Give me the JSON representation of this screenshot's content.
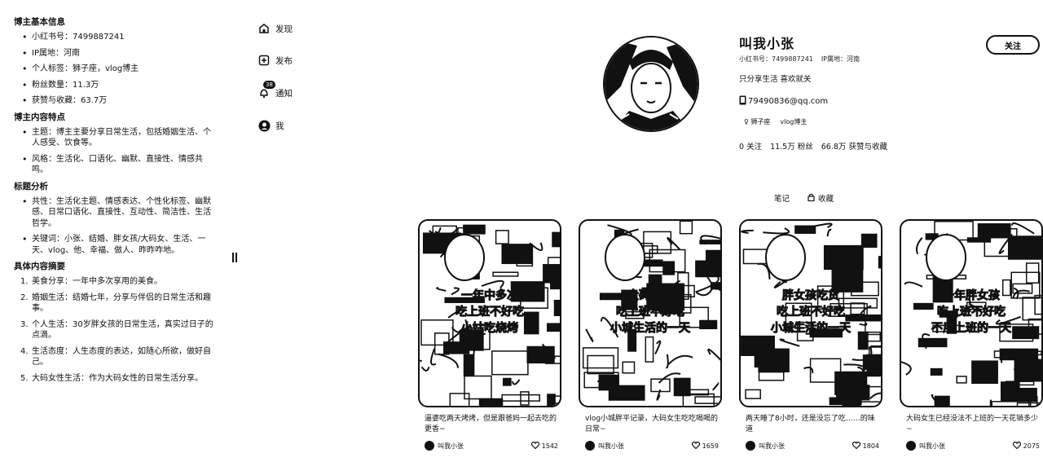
{
  "left_panel": {
    "sections": [
      {
        "title": "博主基本信息",
        "type": "bullets",
        "items": [
          "小红书号：7499887241",
          "IP属地：河南",
          "个人标签：狮子座，vlog博主",
          "粉丝数量：11.3万",
          "获赞与收藏：63.7万"
        ]
      },
      {
        "title": "博主内容特点",
        "type": "bullets",
        "items": [
          "主题：博主主要分享日常生活，包括婚姻生活、个人感受、饮食等。",
          "风格：生活化、口语化、幽默、直接性、情感共鸣。"
        ]
      },
      {
        "title": "标题分析",
        "type": "bullets",
        "items": [
          "共性：生活化主题、情感表达、个性化标签、幽默感、日常口语化、直接性、互动性、简洁性、生活哲学。",
          "关键词：小张、结婚、胖女孩/大码女、生活、一天、vlog、他、幸福、做人、昨昨咋地。"
        ]
      },
      {
        "title": "具体内容摘要",
        "type": "numbered",
        "items": [
          "美食分享：一年中多次享用的美食。",
          "婚姻生活：结婚七年，分享与伴侣的日常生活和趣事。",
          "个人生活：30岁胖女孩的日常生活，真实过日子的点滴。",
          "生活态度：人生态度的表达，如随心所欲，做好自己。",
          "大码女性生活：作为大码女性的日常生活分享。"
        ]
      }
    ]
  },
  "nav": {
    "items": [
      {
        "label": "发现",
        "icon": "home-icon"
      },
      {
        "label": "发布",
        "icon": "plus-square-icon"
      },
      {
        "label": "通知",
        "icon": "bell-icon",
        "badge": "38"
      },
      {
        "label": "我",
        "icon": "user-avatar-icon"
      }
    ]
  },
  "profile": {
    "name": "叫我小张",
    "id_label": "小红书号：7499887241",
    "ip_label": "IP属地：河南",
    "description": "只分享生活 喜欢就关",
    "email": "79490836@qq.com",
    "tags": [
      "♀ 狮子座",
      "vlog博主"
    ],
    "stats": {
      "following": "0 关注",
      "followers": "11.5万 粉丝",
      "likes": "66.8万 获赞与收藏"
    },
    "follow_label": "关注"
  },
  "tabs": {
    "notes": "笔记",
    "collections": "收藏"
  },
  "notes": [
    {
      "title": "逼婆吃两天烤烤，但是跟爸妈一起去吃的更香~",
      "author": "叫我小张",
      "likes": "1542",
      "overlay": [
        "一年中多次",
        "吃上班不好吃",
        "小姑吃烧烤"
      ]
    },
    {
      "title": "vlog小城胖平记录，大码女生吃吃喝喝的日常~",
      "author": "叫我小张",
      "likes": "1659",
      "overlay": [
        "大码女生",
        "吃上班不好吃",
        "小城生活的一天"
      ]
    },
    {
      "title": "两天睡了8小时，还是没忘了吃……的味道",
      "author": "叫我小张",
      "likes": "1804",
      "overlay": [
        "胖女孩吃货",
        "吃上班不好吃",
        "小城生活的一天"
      ]
    },
    {
      "title": "大码女生已经没法不上班的一天花销多少~",
      "author": "叫我小张",
      "likes": "2075",
      "overlay": [
        "一年胖女孩",
        "吃上班不好吃",
        "不用上班的一天"
      ]
    }
  ]
}
